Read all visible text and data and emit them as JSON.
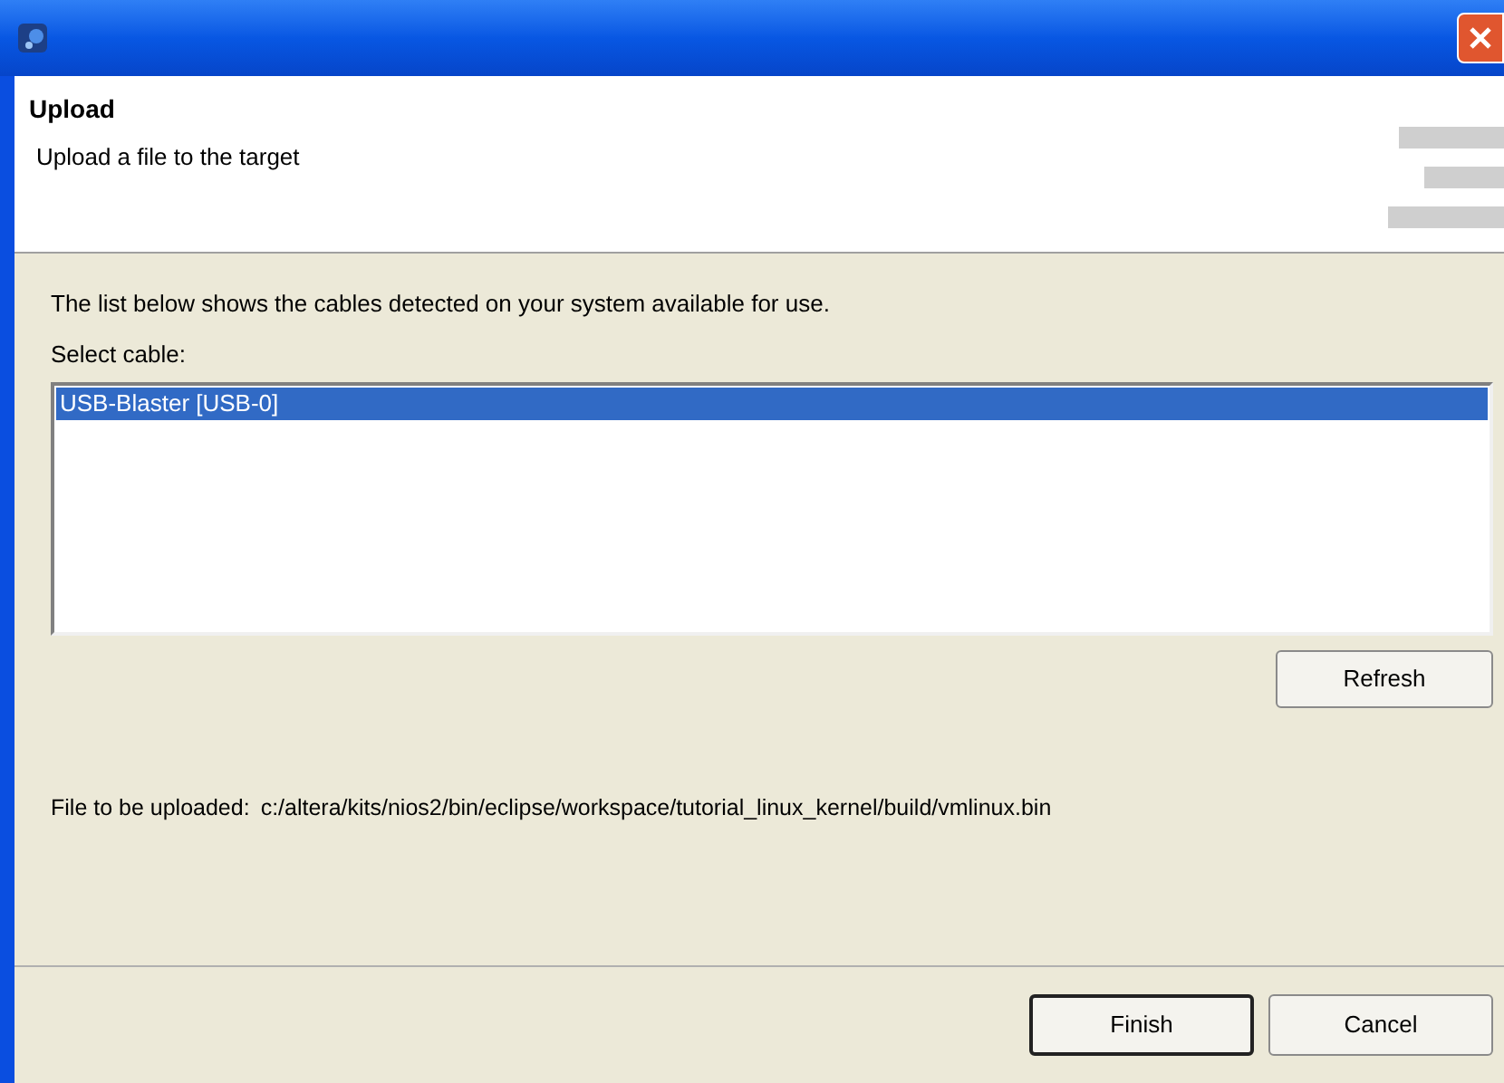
{
  "header": {
    "title": "Upload",
    "description": "Upload a file to the target"
  },
  "intro": "The list below shows the cables detected on your system available for use.",
  "cable_label": "Select cable:",
  "cables": [
    {
      "label": "USB-Blaster [USB-0]",
      "selected": true
    }
  ],
  "refresh_button": "Refresh",
  "file_label": "File to be uploaded:",
  "file_path": "c:/altera/kits/nios2/bin/eclipse/workspace/tutorial_linux_kernel/build/vmlinux.bin",
  "buttons": [
    {
      "label": "Finish",
      "default": true
    },
    {
      "label": "Cancel",
      "default": false
    }
  ]
}
